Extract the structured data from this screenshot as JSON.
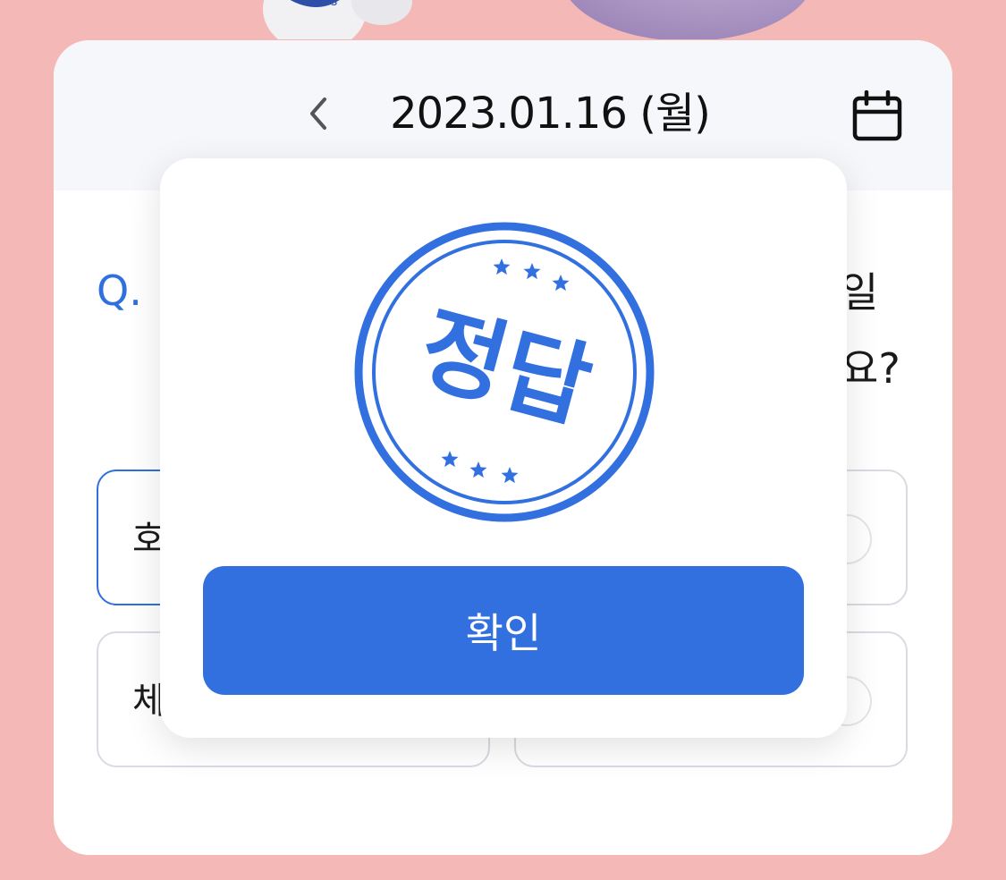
{
  "header": {
    "date": "2023.01.16 (월)",
    "prev_icon": "chevron-left-icon",
    "calendar_icon": "calendar-icon"
  },
  "question": {
    "prefix": "Q.",
    "line1_visible": "일",
    "line2_visible": "요?"
  },
  "options": [
    {
      "label": "호",
      "selected": true
    },
    {
      "label": "",
      "selected": false
    },
    {
      "label": "체",
      "selected": false
    },
    {
      "label": "",
      "selected": false
    }
  ],
  "modal": {
    "stamp_text": "정답",
    "confirm_label": "확인"
  },
  "colors": {
    "background": "#f4b8b7",
    "accent": "#3270e0",
    "question_prefix": "#2f6fde"
  }
}
